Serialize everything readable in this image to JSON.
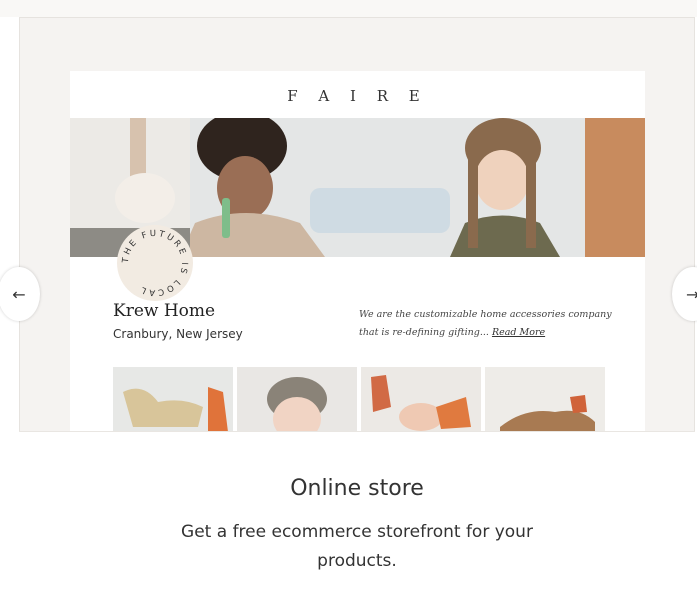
{
  "preview": {
    "brand": "F A I R E",
    "badge_text": "THE FUTURE IS LOCAL",
    "store_name": "Krew Home",
    "store_location": "Cranbury, New Jersey",
    "description": "We are the customizable home accessories company that is re-defining gifting...",
    "read_more": "Read More"
  },
  "feature": {
    "title": "Online store",
    "text": "Get a free ecommerce storefront for your products."
  },
  "nav": {
    "prev_glyph": "←",
    "next_glyph": "→"
  }
}
